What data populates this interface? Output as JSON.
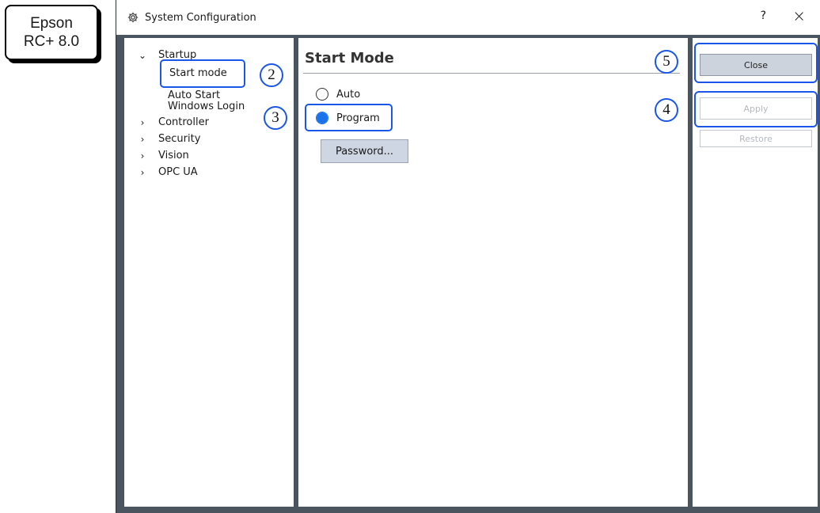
{
  "badge": {
    "line1": "Epson",
    "line2": "RC+ 8.0"
  },
  "window": {
    "title": "System Configuration",
    "help_label": "?",
    "close_label": "×",
    "title_icon": "gear-icon"
  },
  "tree": {
    "expanded_glyph": "⌄",
    "collapsed_glyph": "›",
    "startup": {
      "label": "Startup",
      "children": [
        "Start mode",
        "Auto Start",
        "Windows Login"
      ]
    },
    "items": [
      "Controller",
      "Security",
      "Vision",
      "OPC UA"
    ]
  },
  "main": {
    "title": "Start Mode",
    "options": [
      {
        "label": "Auto",
        "selected": false
      },
      {
        "label": "Program",
        "selected": true
      }
    ],
    "password_button": "Password..."
  },
  "buttons": {
    "close": "Close",
    "apply": "Apply",
    "restore": "Restore"
  },
  "callouts": [
    "2",
    "3",
    "4",
    "5"
  ],
  "colors": {
    "accent": "#1a56e8",
    "radio_selected": "#1a73e8",
    "frame": "#4b5560"
  }
}
